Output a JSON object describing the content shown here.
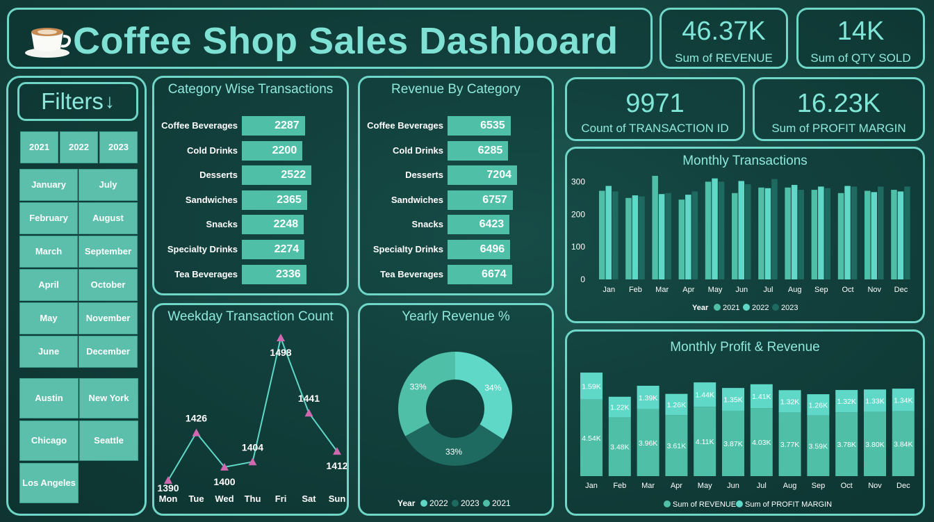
{
  "header": {
    "title": "Coffee Shop Sales Dashboard",
    "icon": "coffee-cup-icon"
  },
  "kpis": {
    "revenue": {
      "value": "46.37K",
      "label": "Sum of REVENUE"
    },
    "qty": {
      "value": "14K",
      "label": "Sum of QTY SOLD"
    },
    "transactions": {
      "value": "9971",
      "label": "Count of TRANSACTION ID"
    },
    "profit": {
      "value": "16.23K",
      "label": "Sum of PROFIT MARGIN"
    }
  },
  "filters": {
    "title": "Filters",
    "years": [
      "2021",
      "2022",
      "2023"
    ],
    "months_left": [
      "January",
      "February",
      "March",
      "April",
      "May",
      "June"
    ],
    "months_right": [
      "July",
      "August",
      "September",
      "October",
      "November",
      "December"
    ],
    "cities_left": [
      "Austin",
      "Chicago",
      "Los Angeles"
    ],
    "cities_right": [
      "New York",
      "Seattle"
    ]
  },
  "colors": {
    "accent": "#6fd6c8",
    "bar": "#4fbfa7",
    "s2021": "#4fbfa7",
    "s2022": "#5fd8c8",
    "s2023": "#1f6a60",
    "marker": "#d068b0"
  },
  "chart_data": [
    {
      "type": "bar",
      "title": "Category Wise Transactions",
      "orientation": "horizontal",
      "categories": [
        "Coffee Beverages",
        "Cold Drinks",
        "Desserts",
        "Sandwiches",
        "Snacks",
        "Specialty Drinks",
        "Tea Beverages"
      ],
      "values": [
        2287,
        2200,
        2522,
        2365,
        2248,
        2274,
        2336
      ]
    },
    {
      "type": "bar",
      "title": "Revenue By Category",
      "orientation": "horizontal",
      "categories": [
        "Coffee Beverages",
        "Cold Drinks",
        "Desserts",
        "Sandwiches",
        "Snacks",
        "Specialty Drinks",
        "Tea Beverages"
      ],
      "values": [
        6535,
        6285,
        7204,
        6757,
        6423,
        6496,
        6674
      ]
    },
    {
      "type": "line",
      "title": "Weekday Transaction Count",
      "x": [
        "Mon",
        "Tue",
        "Wed",
        "Thu",
        "Fri",
        "Sat",
        "Sun"
      ],
      "values": [
        1390,
        1426,
        1400,
        1404,
        1498,
        1441,
        1412
      ]
    },
    {
      "type": "pie",
      "title": "Yearly Revenue %",
      "donut": true,
      "legend_title": "Year",
      "legend": [
        "2022",
        "2023",
        "2021"
      ],
      "slices": [
        {
          "name": "2022",
          "value": 34,
          "label": "34%"
        },
        {
          "name": "2023",
          "value": 33,
          "label": "33%"
        },
        {
          "name": "2021",
          "value": 33,
          "label": "33%"
        }
      ]
    },
    {
      "type": "bar",
      "title": "Monthly Transactions",
      "orientation": "vertical",
      "grouped": true,
      "categories": [
        "Jan",
        "Feb",
        "Mar",
        "Apr",
        "May",
        "Jun",
        "Jul",
        "Aug",
        "Sep",
        "Oct",
        "Nov",
        "Dec"
      ],
      "ylim": [
        0,
        320
      ],
      "yticks": [
        "0",
        "100",
        "200",
        "300"
      ],
      "legend_title": "Year",
      "series": [
        {
          "name": "2021",
          "values": [
            272,
            250,
            318,
            245,
            300,
            265,
            282,
            282,
            275,
            265,
            272,
            275
          ]
        },
        {
          "name": "2022",
          "values": [
            287,
            258,
            262,
            260,
            310,
            302,
            280,
            290,
            285,
            287,
            268,
            270
          ]
        },
        {
          "name": "2023",
          "values": [
            270,
            255,
            265,
            270,
            300,
            292,
            308,
            275,
            280,
            285,
            285,
            285
          ]
        }
      ]
    },
    {
      "type": "bar",
      "title": "Monthly Profit & Revenue",
      "orientation": "vertical",
      "stacked": true,
      "categories": [
        "Jan",
        "Feb",
        "Mar",
        "Apr",
        "May",
        "Jun",
        "Jul",
        "Aug",
        "Sep",
        "Oct",
        "Nov",
        "Dec"
      ],
      "series": [
        {
          "name": "Sum of REVENUE",
          "values": [
            4.54,
            3.48,
            3.96,
            3.61,
            4.11,
            3.87,
            4.03,
            3.77,
            3.59,
            3.78,
            3.8,
            3.84
          ],
          "labels": [
            "4.54K",
            "3.48K",
            "3.96K",
            "3.61K",
            "4.11K",
            "3.87K",
            "4.03K",
            "3.77K",
            "3.59K",
            "3.78K",
            "3.80K",
            "3.84K"
          ]
        },
        {
          "name": "Sum of PROFIT MARGIN",
          "values": [
            1.59,
            1.22,
            1.39,
            1.26,
            1.44,
            1.35,
            1.41,
            1.32,
            1.26,
            1.32,
            1.33,
            1.34
          ],
          "labels": [
            "1.59K",
            "1.22K",
            "1.39K",
            "1.26K",
            "1.44K",
            "1.35K",
            "1.41K",
            "1.32K",
            "1.26K",
            "1.32K",
            "1.33K",
            "1.34K"
          ]
        }
      ]
    }
  ]
}
